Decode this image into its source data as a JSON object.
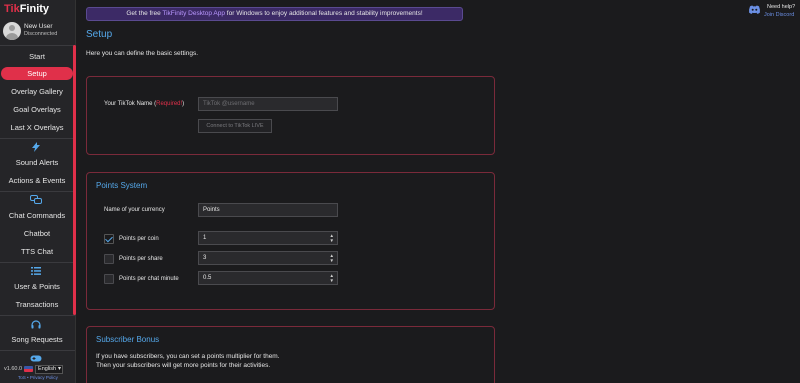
{
  "brand": {
    "part1": "Tik",
    "part2": "Finity"
  },
  "profile": {
    "name": "New User",
    "status": "Disconnected"
  },
  "sidebar": {
    "items": [
      {
        "label": "Start"
      },
      {
        "label": "Setup",
        "active": true
      },
      {
        "label": "Overlay Gallery"
      },
      {
        "label": "Goal Overlays"
      },
      {
        "label": "Last X Overlays"
      },
      {
        "label": "Sound Alerts"
      },
      {
        "label": "Actions & Events"
      },
      {
        "label": "Chat Commands"
      },
      {
        "label": "Chatbot"
      },
      {
        "label": "TTS Chat"
      },
      {
        "label": "User & Points"
      },
      {
        "label": "Transactions"
      },
      {
        "label": "Song Requests"
      }
    ],
    "group_icons": [
      "lightning-icon",
      "chat-bubbles-icon",
      "list-icon",
      "headphones-icon",
      "gamepad-icon"
    ]
  },
  "footer": {
    "version": "v1.60.0",
    "language": "English",
    "links": "ToS • Privacy Policy"
  },
  "banner": {
    "pre": "Get the free ",
    "link": "TikFinity Desktop App",
    "post": " for Windows to enjoy additional features and stability improvements!"
  },
  "page": {
    "title": "Setup",
    "intro": "Here you can define the basic settings."
  },
  "tiktok": {
    "label": "Your TikTok Name (",
    "required": "Required!",
    "label_end": ")",
    "placeholder": "TikTok @username",
    "connect_button": "Connect to TikTok LIVE"
  },
  "points": {
    "title": "Points System",
    "currency_label": "Name of your currency",
    "currency_value": "Points",
    "rows": [
      {
        "label": "Points per coin",
        "value": "1",
        "checked": true
      },
      {
        "label": "Points per share",
        "value": "3",
        "checked": false
      },
      {
        "label": "Points per chat minute",
        "value": "0.5",
        "checked": false
      }
    ]
  },
  "subscriber": {
    "title": "Subscriber Bonus",
    "line1": "If you have subscribers, you can set a points multiplier for them.",
    "line2": "Then your subscribers will get more points for their activities."
  },
  "help": {
    "title": "Need help?",
    "link": "Join Discord"
  },
  "colors": {
    "accent": "#e0304a",
    "link": "#55a8ea",
    "panel_border": "#7a2a3a",
    "banner": "#3c2a66"
  }
}
